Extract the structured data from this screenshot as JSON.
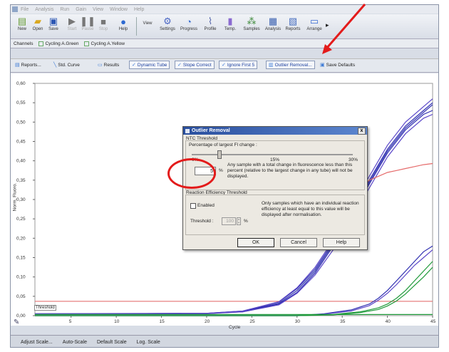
{
  "menu": [
    "File",
    "Analysis",
    "Run",
    "Gain",
    "View",
    "Window",
    "Help"
  ],
  "toolbar": {
    "left": [
      {
        "label": "New",
        "icon": "new-file-icon"
      },
      {
        "label": "Open",
        "icon": "open-folder-icon"
      },
      {
        "label": "Save",
        "icon": "save-disk-icon"
      },
      {
        "label": "Start",
        "icon": "play-icon"
      },
      {
        "label": "Pause",
        "icon": "pause-icon"
      },
      {
        "label": "Stop",
        "icon": "stop-icon"
      },
      {
        "label": "Help",
        "icon": "help-icon"
      }
    ],
    "right": [
      {
        "label": "Settings",
        "icon": "settings-icon"
      },
      {
        "label": "Progress",
        "icon": "progress-icon"
      },
      {
        "label": "Profile",
        "icon": "profile-icon"
      },
      {
        "label": "Temp.",
        "icon": "thermometer-icon"
      },
      {
        "label": "Samples",
        "icon": "samples-icon"
      },
      {
        "label": "Analysis",
        "icon": "analysis-icon"
      },
      {
        "label": "Reports",
        "icon": "reports-icon"
      },
      {
        "label": "Arrange",
        "icon": "arrange-icon"
      }
    ],
    "view_label": "View"
  },
  "channels": {
    "label": "Channels",
    "tabs": [
      "Cycling A.Green",
      "Cycling A.Yellow"
    ]
  },
  "actions": [
    "Reports...",
    "Std. Curve",
    "Results",
    "Dynamic Tube",
    "Slope Correct",
    "Ignore First 5",
    "Outlier Removal...",
    "Save Defaults"
  ],
  "chart_data": {
    "type": "line",
    "xlabel": "Cycle",
    "ylabel": "Norm. Fluoro.",
    "xlim": [
      1,
      45
    ],
    "ylim": [
      0,
      0.6
    ],
    "yticks": [
      "0,00",
      "0,05",
      "0,10",
      "0,15",
      "0,20",
      "0,25",
      "0,30",
      "0,35",
      "0,40",
      "0,45",
      "0,50",
      "0,55",
      "0,60"
    ],
    "xticks": [
      "5",
      "10",
      "15",
      "20",
      "25",
      "30",
      "35",
      "40",
      "45"
    ],
    "threshold_label": "Threshold",
    "threshold_value": 0.037,
    "colors": {
      "blue": "#2f2fb0",
      "purple": "#5a46c8",
      "green": "#1f9a3a",
      "red": "#e56a6a",
      "threshold": "#e26060"
    },
    "series": [
      {
        "color": "blue",
        "x": [
          1,
          20,
          24,
          28,
          30,
          32,
          34,
          36,
          38,
          40,
          42,
          44,
          45
        ],
        "y": [
          0.005,
          0.006,
          0.01,
          0.03,
          0.06,
          0.11,
          0.18,
          0.26,
          0.34,
          0.42,
          0.48,
          0.52,
          0.53
        ]
      },
      {
        "color": "blue",
        "x": [
          1,
          20,
          24,
          28,
          30,
          32,
          34,
          36,
          38,
          40,
          42,
          44,
          45
        ],
        "y": [
          0.004,
          0.006,
          0.012,
          0.035,
          0.07,
          0.12,
          0.19,
          0.27,
          0.35,
          0.43,
          0.49,
          0.53,
          0.55
        ]
      },
      {
        "color": "blue",
        "x": [
          1,
          20,
          24,
          28,
          30,
          32,
          34,
          36,
          38,
          40,
          42,
          44,
          45
        ],
        "y": [
          0.004,
          0.005,
          0.011,
          0.032,
          0.065,
          0.115,
          0.185,
          0.265,
          0.345,
          0.425,
          0.485,
          0.525,
          0.545
        ]
      },
      {
        "color": "purple",
        "x": [
          1,
          20,
          24,
          28,
          30,
          32,
          34,
          36,
          38,
          40,
          42,
          44,
          45
        ],
        "y": [
          0.005,
          0.005,
          0.01,
          0.028,
          0.058,
          0.105,
          0.17,
          0.25,
          0.33,
          0.41,
          0.47,
          0.51,
          0.52
        ]
      },
      {
        "color": "purple",
        "x": [
          1,
          20,
          24,
          28,
          30,
          32,
          34,
          36,
          38,
          40,
          42,
          44,
          45
        ],
        "y": [
          0.004,
          0.006,
          0.012,
          0.036,
          0.072,
          0.125,
          0.195,
          0.28,
          0.36,
          0.44,
          0.5,
          0.54,
          0.56
        ]
      },
      {
        "color": "blue",
        "x": [
          1,
          30,
          33,
          36,
          38,
          39,
          40,
          41,
          42,
          43,
          44,
          45
        ],
        "y": [
          0.0,
          0.0,
          0.005,
          0.015,
          0.03,
          0.045,
          0.065,
          0.09,
          0.115,
          0.14,
          0.165,
          0.18
        ]
      },
      {
        "color": "purple",
        "x": [
          1,
          30,
          33,
          36,
          38,
          39,
          40,
          41,
          42,
          43,
          44,
          45
        ],
        "y": [
          0.0,
          0.0,
          0.004,
          0.012,
          0.026,
          0.04,
          0.058,
          0.08,
          0.105,
          0.13,
          0.15,
          0.17
        ]
      },
      {
        "color": "green",
        "x": [
          1,
          30,
          34,
          37,
          39,
          40,
          41,
          42,
          43,
          44,
          45
        ],
        "y": [
          0.0,
          0.0,
          0.003,
          0.01,
          0.02,
          0.03,
          0.045,
          0.065,
          0.09,
          0.115,
          0.14
        ]
      },
      {
        "color": "green",
        "x": [
          1,
          30,
          34,
          37,
          39,
          40,
          41,
          42,
          43,
          44,
          45
        ],
        "y": [
          0.0,
          0.0,
          0.002,
          0.008,
          0.016,
          0.025,
          0.038,
          0.056,
          0.078,
          0.1,
          0.125
        ]
      },
      {
        "color": "red",
        "x": [
          36,
          37,
          38,
          39,
          40,
          41,
          42,
          43,
          44,
          45
        ],
        "y": [
          0.3,
          0.33,
          0.35,
          0.36,
          0.37,
          0.375,
          0.38,
          0.385,
          0.39,
          0.393
        ]
      },
      {
        "color": "green",
        "x": [
          1,
          45
        ],
        "y": [
          0.003,
          0.003
        ]
      }
    ]
  },
  "footer": [
    "Adjust Scale...",
    "Auto-Scale",
    "Default Scale",
    "Log. Scale"
  ],
  "dialog": {
    "title": "Outlier Removal",
    "close": "x",
    "ntc_group": "NTC Threshold",
    "ntc_caption": "Percentage of largest Fl change :",
    "slider_labels": [
      "0%",
      "15%",
      "30%"
    ],
    "slider_value_percent": 5,
    "percent_value": "5",
    "percent_unit": "%",
    "ntc_desc": "Any sample with a total change in fluorescence less than this percent (relative to the largest change in any tube) will not be displayed.",
    "eff_group": "Reaction Efficiency Threshold",
    "enabled_label": "Enabled",
    "enabled": false,
    "eff_desc": "Only samples which have an individual reaction efficiency at least equal to this value will be displayed after normalisation.",
    "threshold_label": "Threshold :",
    "threshold_value": "100",
    "threshold_unit": "%",
    "ok": "OK",
    "cancel": "Cancel",
    "help": "Help"
  }
}
